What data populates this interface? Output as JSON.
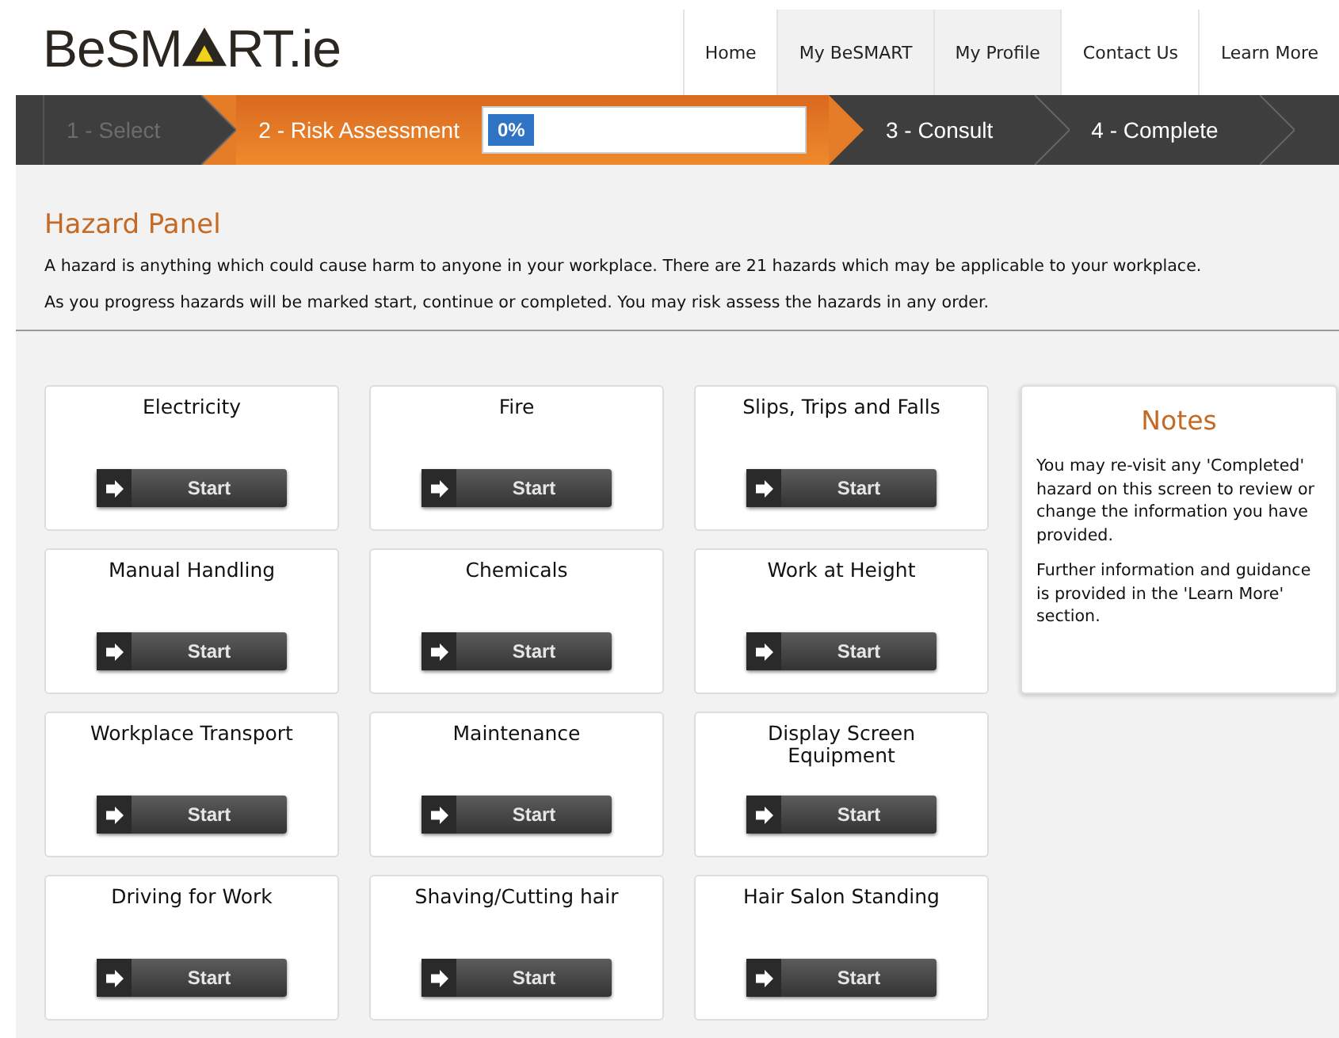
{
  "header": {
    "logo_before": "BeSM",
    "logo_after": "RT.ie",
    "nav": [
      {
        "label": "Home",
        "selected": false
      },
      {
        "label": "My BeSMART",
        "selected": true
      },
      {
        "label": "My Profile",
        "selected": true
      },
      {
        "label": "Contact Us",
        "selected": false
      },
      {
        "label": "Learn More",
        "selected": false
      }
    ]
  },
  "steps": [
    {
      "label": "1 - Select",
      "selected": false,
      "disabled": true
    },
    {
      "label": "2 - Risk Assessment",
      "selected": true,
      "disabled": false,
      "progress": {
        "level": 0,
        "reading": "0%"
      }
    },
    {
      "label": "3 - Consult",
      "selected": false,
      "disabled": false
    },
    {
      "label": "4 - Complete",
      "selected": false,
      "disabled": false
    }
  ],
  "panel": {
    "title": "Hazard Panel",
    "paragraphs": [
      "A hazard is anything which could cause harm to anyone in your workplace. There are 21 hazards which may be applicable to your workplace.",
      "As you progress hazards will be marked start, continue or completed. You may risk assess the hazards in any order."
    ]
  },
  "hazards": [
    {
      "name": "Electricity",
      "button": "Start"
    },
    {
      "name": "Fire",
      "button": "Start"
    },
    {
      "name": "Slips, Trips and Falls",
      "button": "Start"
    },
    {
      "name": "Manual Handling",
      "button": "Start"
    },
    {
      "name": "Chemicals",
      "button": "Start"
    },
    {
      "name": "Work at Height",
      "button": "Start"
    },
    {
      "name": "Workplace Transport",
      "button": "Start"
    },
    {
      "name": "Maintenance",
      "button": "Start"
    },
    {
      "name": "Display Screen Equipment",
      "button": "Start"
    },
    {
      "name": "Driving for Work",
      "button": "Start"
    },
    {
      "name": "Shaving/Cutting hair",
      "button": "Start"
    },
    {
      "name": "Hair Salon Standing",
      "button": "Start"
    }
  ],
  "notes": {
    "title": "Notes",
    "paragraphs": [
      "You may re-visit any 'Completed' hazard on this screen to review or change the information you have provided.",
      "Further information and guidance is provided in the 'Learn More' section."
    ]
  }
}
